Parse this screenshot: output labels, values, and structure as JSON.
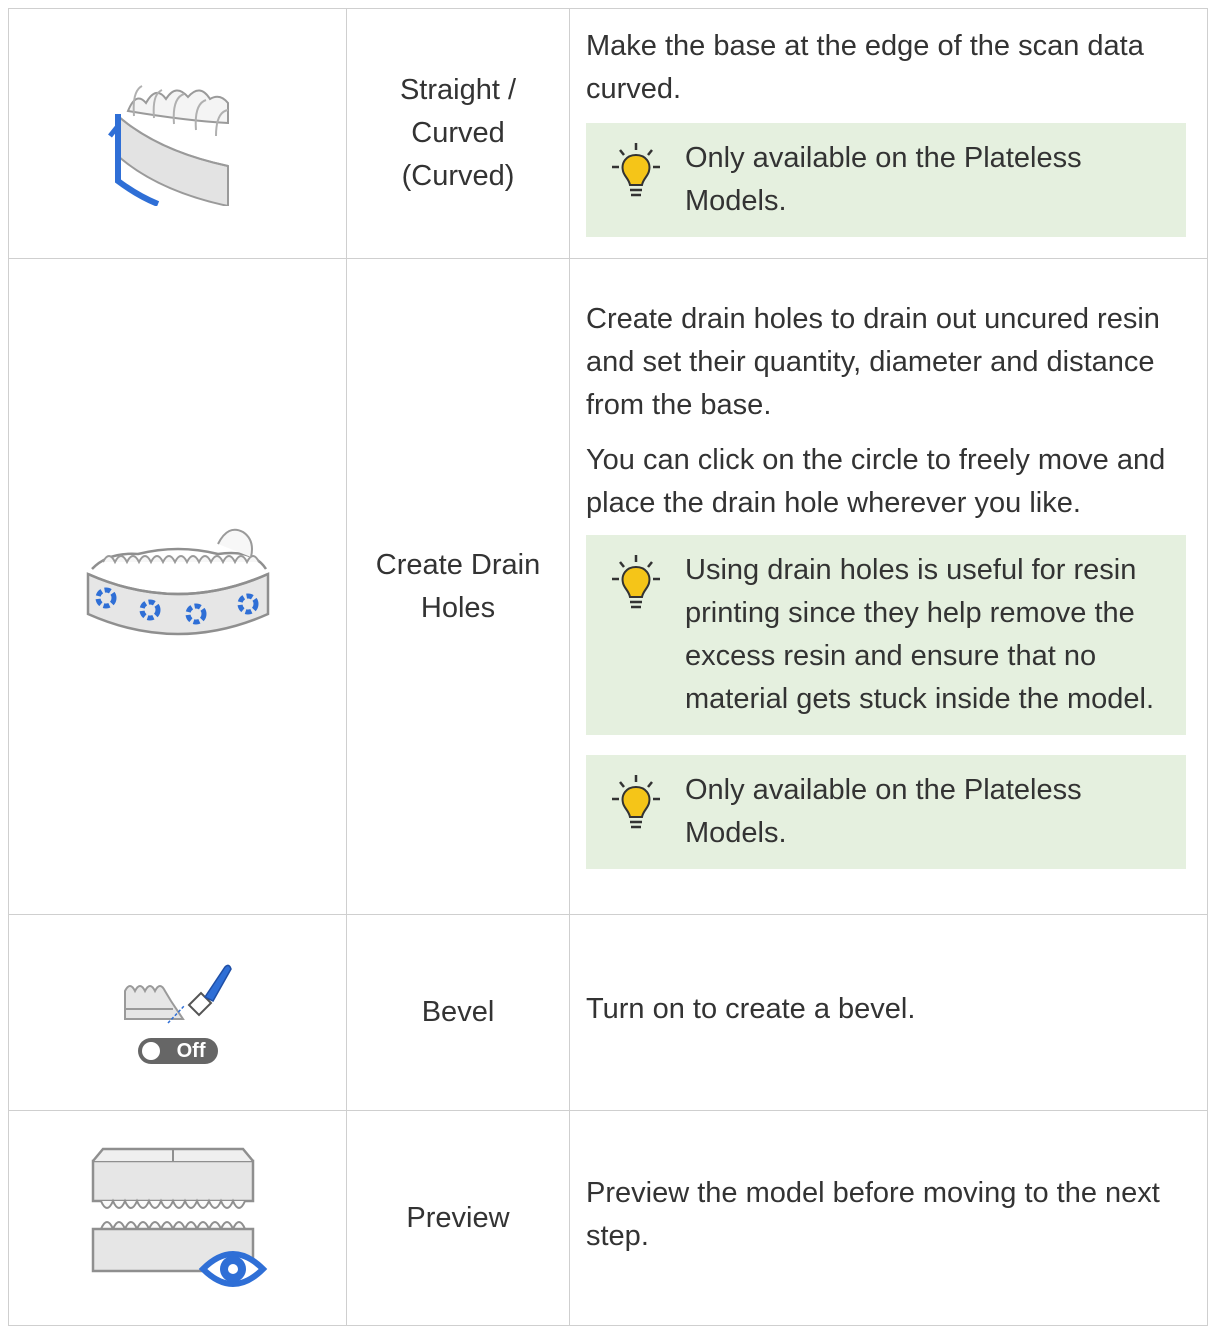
{
  "rows": [
    {
      "icon": "curved-base-icon",
      "name": "Straight /\nCurved\n(Curved)",
      "description": [
        "Make the base at the edge of the scan data curved."
      ],
      "tips": [
        "Only available on the Plateless Models."
      ]
    },
    {
      "icon": "drain-holes-icon",
      "name": "Create Drain Holes",
      "description": [
        "Create drain holes to drain out uncured resin and set their quantity, diameter and distance from the base.",
        "You can click on the circle to freely move and place the drain hole wherever you like."
      ],
      "tips": [
        "Using drain holes is useful for resin printing since they help remove the excess resin and ensure that no material gets stuck inside the model.",
        "Only available on the Plateless Models."
      ]
    },
    {
      "icon": "bevel-icon",
      "toggle_label": "Off",
      "name": "Bevel",
      "description": [
        "Turn on to create a bevel."
      ],
      "tips": []
    },
    {
      "icon": "preview-eye-icon",
      "name": "Preview",
      "description": [
        "Preview the model before moving to the next step."
      ],
      "tips": []
    }
  ],
  "colors": {
    "tip_background": "#e5f0df",
    "accent_blue": "#2f6fd6",
    "bulb_yellow": "#f5c518",
    "border": "#cfcfcf"
  }
}
